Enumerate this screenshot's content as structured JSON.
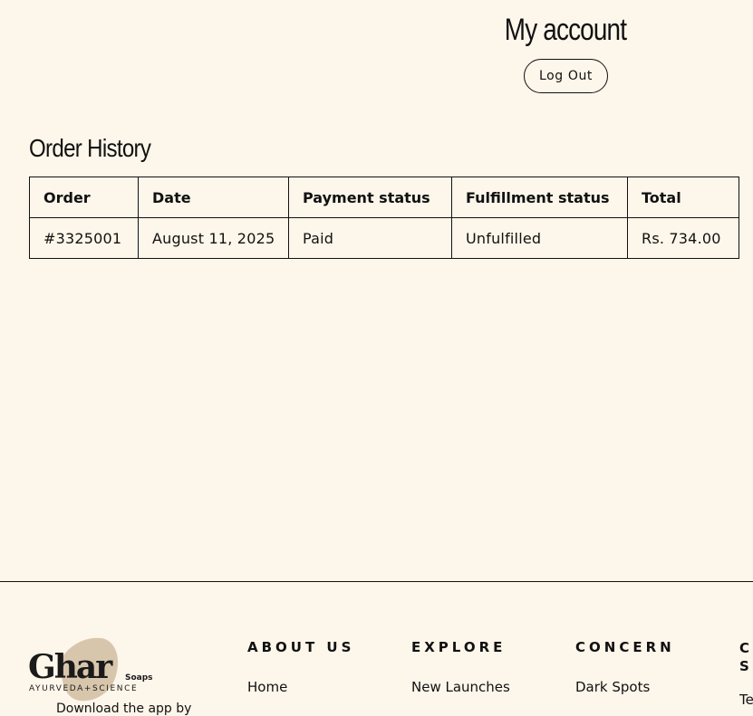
{
  "account": {
    "title": "My account",
    "logout_label": "Log Out"
  },
  "orders": {
    "section_title": "Order History",
    "columns": [
      "Order",
      "Date",
      "Payment status",
      "Fulfillment status",
      "Total"
    ],
    "rows": [
      {
        "order": "#3325001",
        "date": "August 11, 2025",
        "payment_status": "Paid",
        "fulfillment_status": "Unfulfilled",
        "total": "Rs. 734.00"
      }
    ]
  },
  "footer": {
    "logo": {
      "brand": "Ghar",
      "sub": "Soaps",
      "tagline": "AYURVEDA+SCIENCE"
    },
    "download_text": "Download the app by",
    "columns": [
      {
        "heading": "ABOUT US",
        "first_link": "Home"
      },
      {
        "heading": "EXPLORE",
        "first_link": "New Launches"
      },
      {
        "heading": "CONCERN",
        "first_link": "Dark Spots"
      }
    ],
    "partial_column": {
      "heading_line1": "CU",
      "heading_line2": "SI",
      "first_link": "Te"
    }
  },
  "colors": {
    "background": "#fdf6ea",
    "text": "#111111",
    "logo_leaf": "#d8c6ac"
  }
}
